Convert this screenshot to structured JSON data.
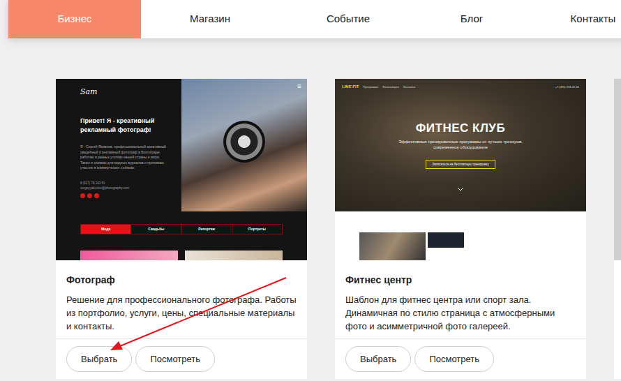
{
  "nav": [
    {
      "label": "Бизнес",
      "selected": true
    },
    {
      "label": "Магазин",
      "selected": false
    },
    {
      "label": "Событие",
      "selected": false
    },
    {
      "label": "Блог",
      "selected": false
    },
    {
      "label": "Контакты",
      "selected": false
    }
  ],
  "templates": [
    {
      "kind": "photographer",
      "title": "Фотограф",
      "description": "Решение для профессионального фотографа. Работы из портфолио, услуги, цены, специальные материалы и контакты.",
      "buttons": [
        "Выбрать",
        "Посмотреть"
      ],
      "preview": {
        "logo": "Sam",
        "menu_icon": "≡",
        "heading": "Привет! Я - креативный рекламный фотограф!",
        "text": "Я - Сергей Яковлев, профессиональный креативный свадебный и рекламный фотограф в Волгограде, работаю в разных уголках нашей страны и мира. Также я снимаю для модных журналов и принимаю участие в коммерческих съёмках.",
        "phone": "8 (917) 78 343 51",
        "email": "sergeyyakovlev@photography.com",
        "tabs": [
          {
            "label": "Мода",
            "selected": true
          },
          {
            "label": "Свадьбы",
            "selected": false
          },
          {
            "label": "Репортаж",
            "selected": false
          },
          {
            "label": "Портреты",
            "selected": false
          }
        ]
      }
    },
    {
      "kind": "fitness",
      "title": "Фитнес центр",
      "description": "Шаблон для фитнес центра или спорт зала. Динамичная по стилю страница с атмосферными фото и асимметричной фото галереей.",
      "buttons": [
        "Выбрать",
        "Посмотреть"
      ],
      "preview": {
        "brand": "LINE FIT",
        "menu": [
          "Программы",
          "Фотогалерея",
          "Контакты"
        ],
        "phone": "+7 (495) 558-45-32",
        "heading": "ФИТНЕС КЛУБ",
        "subheading": "Эффективные тренировочные программы от лучших тренеров, современное оборудование",
        "cta": "Записаться на бесплатную тренировку"
      }
    }
  ]
}
